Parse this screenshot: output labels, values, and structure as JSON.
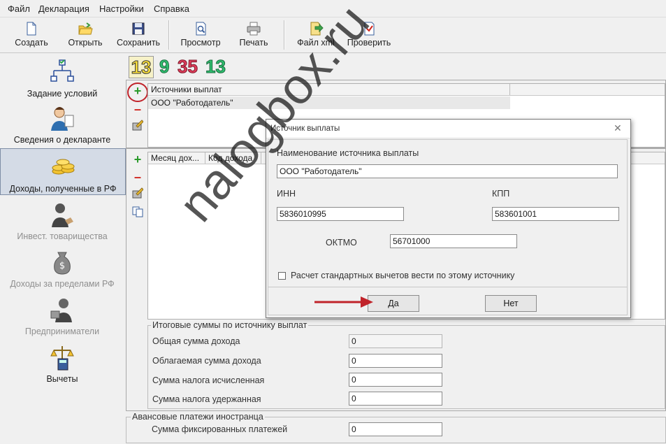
{
  "menu": [
    "Файл",
    "Декларация",
    "Настройки",
    "Справка"
  ],
  "toolbar": {
    "create": "Создать",
    "open": "Открыть",
    "save": "Сохранить",
    "preview": "Просмотр",
    "print": "Печать",
    "xml": "Файл xml",
    "check": "Проверить"
  },
  "nav": {
    "conditions": "Задание условий",
    "declarant": "Сведения о декларанте",
    "income_rf": "Доходы, полученные в РФ",
    "invest": "Инвест. товарищества",
    "income_abroad": "Доходы за пределами РФ",
    "entrepreneurs": "Предприниматели",
    "deductions": "Вычеты"
  },
  "rates": [
    "13",
    "9",
    "35",
    "13"
  ],
  "rate_colors": [
    "#ffe23a",
    "#2fbf6f",
    "#e03c5a",
    "#2fbf6f"
  ],
  "sources_table": {
    "header": "Источники выплат",
    "rows": [
      "ООО \"Работодатель\""
    ]
  },
  "income_table": {
    "headers": [
      "Месяц дох...",
      "Код дохода"
    ]
  },
  "totals": {
    "title": "Итоговые суммы по источнику выплат",
    "total_income_label": "Общая сумма дохода",
    "total_income": "0",
    "taxable_label": "Облагаемая сумма дохода",
    "taxable": "0",
    "tax_calc_label": "Сумма налога исчисленная",
    "tax_calc": "0",
    "tax_withheld_label": "Сумма налога удержанная",
    "tax_withheld": "0"
  },
  "advance": {
    "title": "Авансовые платежи иностранца",
    "fixed_label": "Сумма фиксированных платежей",
    "fixed": "0"
  },
  "dialog": {
    "title": "Источник выплаты",
    "name_label": "Наименование источника выплаты",
    "name_value": "ООО \"Работодатель\"",
    "inn_label": "ИНН",
    "inn_value": "5836010995",
    "kpp_label": "КПП",
    "kpp_value": "583601001",
    "oktmo_label": "ОКТМО",
    "oktmo_value": "56701000",
    "checkbox_label": "Расчет стандартных вычетов вести по этому источнику",
    "checkbox_checked": false,
    "yes": "Да",
    "no": "Нет",
    "close": "✕"
  },
  "watermark": "nalogbox.ru"
}
